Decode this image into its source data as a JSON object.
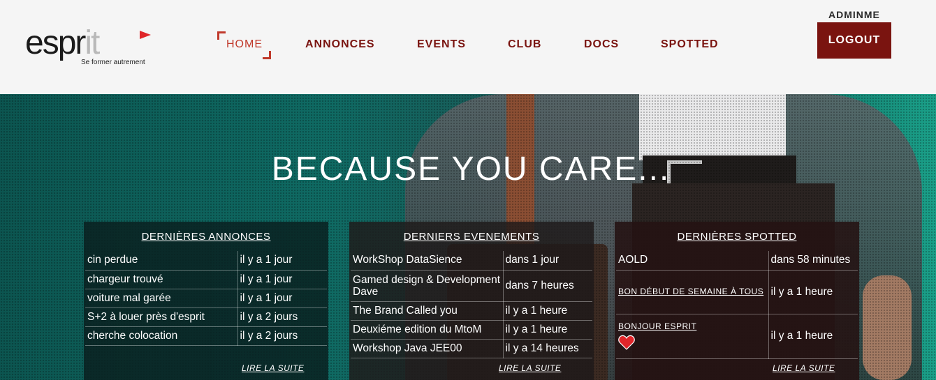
{
  "logo": {
    "word_dark": "espr",
    "word_light": "it",
    "tagline": "Se former autrement"
  },
  "nav": {
    "items": [
      "HOME",
      "ANNONCES",
      "EVENTS",
      "CLUB",
      "DOCS",
      "SPOTTED"
    ],
    "active": "HOME"
  },
  "user": {
    "name": "ADMINME",
    "logout_label": "LOGOUT"
  },
  "hero": {
    "title": "BECAUSE YOU CARE..."
  },
  "panels": {
    "annonces": {
      "title": "DERNIÈRES ANNONCES",
      "rows": [
        [
          "cin perdue",
          "il y a 1 jour"
        ],
        [
          "chargeur trouvé",
          "il y a 1 jour"
        ],
        [
          "voiture mal garée",
          "il y a 1 jour"
        ],
        [
          "S+2 à louer près d'esprit",
          "il y a 2 jours"
        ],
        [
          "cherche colocation",
          "il y a 2 jours"
        ]
      ],
      "more": "LIRE LA SUITE"
    },
    "events": {
      "title": "DERNIERS EVENEMENTS",
      "rows": [
        [
          "WorkShop DataSience",
          "dans 1 jour"
        ],
        [
          "Gamed design & Development Dave",
          "dans 7 heures"
        ],
        [
          "The Brand Called you",
          "il y a 1 heure"
        ],
        [
          "Deuxiéme edition du MtoM",
          "il y a 1 heure"
        ],
        [
          "Workshop Java JEE00",
          "il y a 14 heures"
        ]
      ],
      "more": "LIRE LA SUITE"
    },
    "spotted": {
      "title": "DERNIÈRES SPOTTED",
      "rows": [
        [
          "AOLD",
          "dans 58 minutes"
        ],
        [
          "BON DÉBUT DE SEMAINE À TOUS",
          "il y a 1 heure"
        ],
        [
          "BONJOUR ESPRIT",
          "il y a 1 heure"
        ]
      ],
      "more": "LIRE LA SUITE"
    }
  },
  "colors": {
    "brand": "#7a1410",
    "accent": "#c0392b",
    "heart": "#e0262a"
  }
}
